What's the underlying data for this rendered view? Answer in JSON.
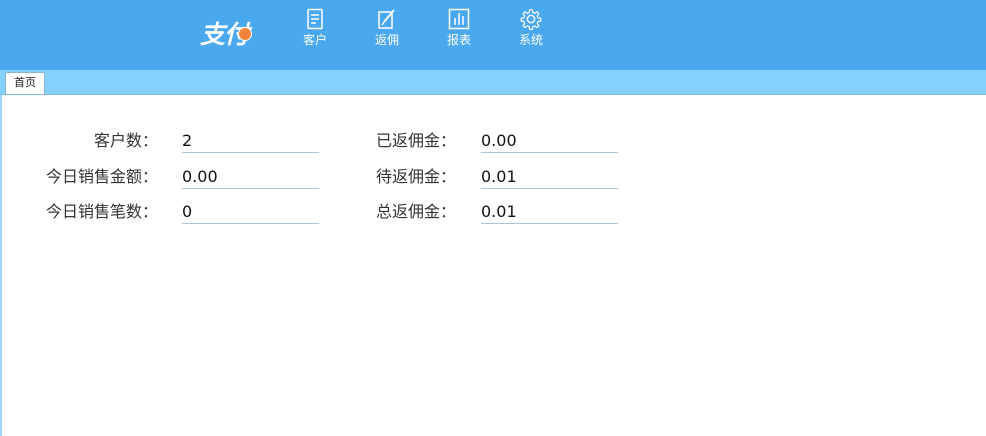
{
  "header": {
    "logo_text": "支付",
    "nav": [
      {
        "label": "客户",
        "icon": "document-icon"
      },
      {
        "label": "返佣",
        "icon": "edit-icon"
      },
      {
        "label": "报表",
        "icon": "bar-chart-icon"
      },
      {
        "label": "系统",
        "icon": "gear-icon"
      }
    ]
  },
  "tabs": [
    {
      "label": "首页"
    }
  ],
  "stats": {
    "left": [
      {
        "label": "客户数：",
        "value": "2"
      },
      {
        "label": "今日销售金额：",
        "value": "0.00"
      },
      {
        "label": "今日销售笔数：",
        "value": "0"
      }
    ],
    "right": [
      {
        "label": "已返佣金：",
        "value": "0.00"
      },
      {
        "label": "待返佣金：",
        "value": "0.01"
      },
      {
        "label": "总返佣金：",
        "value": "0.01"
      }
    ]
  },
  "colors": {
    "header_bg": "#4aa8ee",
    "tabbar_bg": "#84d2fc",
    "logo_accent": "#f0843a"
  }
}
